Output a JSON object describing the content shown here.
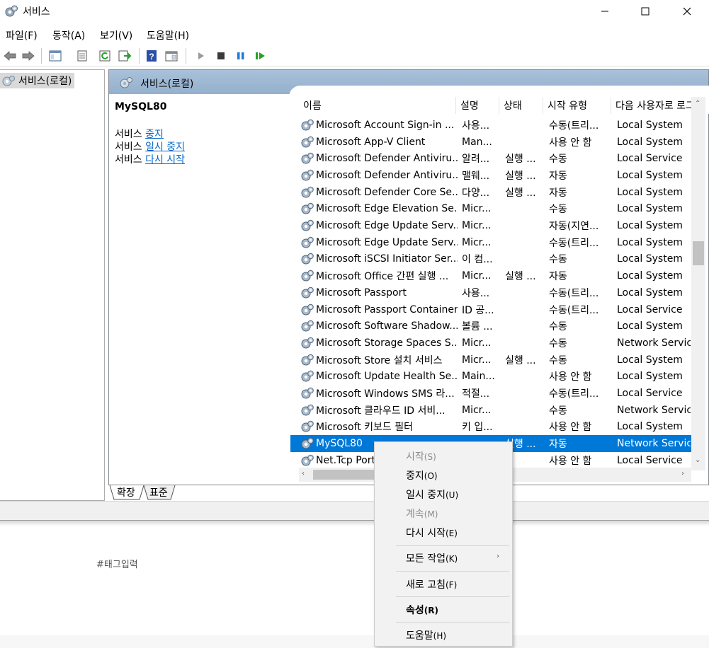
{
  "window": {
    "title": "서비스",
    "controls": {
      "minimize": "—",
      "maximize": "☐",
      "close": "✕"
    }
  },
  "menu": [
    {
      "label": "파일(F)"
    },
    {
      "label": "동작(A)"
    },
    {
      "label": "보기(V)"
    },
    {
      "label": "도움말(H)"
    }
  ],
  "toolbar": [
    "back-icon",
    "forward-icon",
    "show-tree-icon",
    "properties-icon",
    "refresh-icon",
    "export-icon",
    "help-icon",
    "view-icon",
    "start-icon",
    "stop-icon",
    "pause-icon",
    "resume-icon"
  ],
  "tree": {
    "item": "서비스(로컬)"
  },
  "main": {
    "header": "서비스(로컬)",
    "selected_service": "MySQL80",
    "actions": [
      {
        "prefix": "서비스",
        "link": "중지"
      },
      {
        "prefix": "서비스",
        "link": "일시 중지"
      },
      {
        "prefix": "서비스",
        "link": "다시 시작"
      }
    ]
  },
  "list": {
    "columns": [
      "이름",
      "설명",
      "상태",
      "시작 유형",
      "다음 사용자로 로그온"
    ],
    "rows": [
      {
        "name": "Microsoft Account Sign-in ...",
        "desc": "사용...",
        "status": "",
        "start": "수동(트리...",
        "logon": "Local System"
      },
      {
        "name": "Microsoft App-V Client",
        "desc": "Man...",
        "status": "",
        "start": "사용 안 함",
        "logon": "Local System"
      },
      {
        "name": "Microsoft Defender Antiviru...",
        "desc": "알려...",
        "status": "실행 ...",
        "start": "수동",
        "logon": "Local Service"
      },
      {
        "name": "Microsoft Defender Antiviru...",
        "desc": "맬웨...",
        "status": "실행 ...",
        "start": "자동",
        "logon": "Local System"
      },
      {
        "name": "Microsoft Defender Core Se...",
        "desc": "다양...",
        "status": "실행 ...",
        "start": "자동",
        "logon": "Local System"
      },
      {
        "name": "Microsoft Edge Elevation Se...",
        "desc": "Micr...",
        "status": "",
        "start": "수동",
        "logon": "Local System"
      },
      {
        "name": "Microsoft Edge Update Serv...",
        "desc": "Micr...",
        "status": "",
        "start": "자동(지연...",
        "logon": "Local System"
      },
      {
        "name": "Microsoft Edge Update Serv...",
        "desc": "Micr...",
        "status": "",
        "start": "수동(트리...",
        "logon": "Local System"
      },
      {
        "name": "Microsoft iSCSI Initiator Ser...",
        "desc": "이 컴...",
        "status": "",
        "start": "수동",
        "logon": "Local System"
      },
      {
        "name": "Microsoft Office 간편 실행 ...",
        "desc": "Micr...",
        "status": "실행 ...",
        "start": "자동",
        "logon": "Local System"
      },
      {
        "name": "Microsoft Passport",
        "desc": "사용...",
        "status": "",
        "start": "수동(트리...",
        "logon": "Local System"
      },
      {
        "name": "Microsoft Passport Container",
        "desc": "ID 공...",
        "status": "",
        "start": "수동(트리...",
        "logon": "Local Service"
      },
      {
        "name": "Microsoft Software Shadow...",
        "desc": "볼륨 ...",
        "status": "",
        "start": "수동",
        "logon": "Local System"
      },
      {
        "name": "Microsoft Storage Spaces S...",
        "desc": "Micr...",
        "status": "",
        "start": "수동",
        "logon": "Network Service"
      },
      {
        "name": "Microsoft Store 설치 서비스",
        "desc": "Micr...",
        "status": "실행 ...",
        "start": "수동",
        "logon": "Local System"
      },
      {
        "name": "Microsoft Update Health Se...",
        "desc": "Main...",
        "status": "",
        "start": "사용 안 함",
        "logon": "Local System"
      },
      {
        "name": "Microsoft Windows SMS 라...",
        "desc": "적절...",
        "status": "",
        "start": "수동(트리...",
        "logon": "Local Service"
      },
      {
        "name": "Microsoft 클라우드 ID 서비...",
        "desc": "Micr...",
        "status": "",
        "start": "수동",
        "logon": "Network Service"
      },
      {
        "name": "Microsoft 키보드 필터",
        "desc": "키 입...",
        "status": "",
        "start": "사용 안 함",
        "logon": "Local System"
      },
      {
        "name": "MySQL80",
        "desc": "",
        "status": "실행 ...",
        "start": "자동",
        "logon": "Network Service",
        "selected": true
      },
      {
        "name": "Net.Tcp Port",
        "desc": "",
        "status": "",
        "start": "사용 안 함",
        "logon": "Local Service"
      }
    ]
  },
  "tabs": [
    {
      "label": "확장"
    },
    {
      "label": "표준"
    }
  ],
  "background": {
    "tag_input": "#태그입력"
  },
  "context_menu": {
    "items": [
      {
        "label": "시작",
        "acc": "(S)",
        "disabled": true
      },
      {
        "label": "중지",
        "acc": "(O)"
      },
      {
        "label": "일시 중지",
        "acc": "(U)"
      },
      {
        "label": "계속",
        "acc": "(M)",
        "disabled": true
      },
      {
        "label": "다시 시작",
        "acc": "(E)"
      },
      {
        "label": "모든 작업",
        "acc": "(K)"
      },
      {
        "label": "새로 고침",
        "acc": "(F)"
      },
      {
        "label": "속성",
        "acc": "(R)",
        "bold": true
      },
      {
        "label": "도움말",
        "acc": "(H)"
      }
    ],
    "submenu_arrow": "›"
  },
  "colors": {
    "selection": "#0078d7",
    "link": "#0066cc",
    "header": "#a9c1da"
  }
}
